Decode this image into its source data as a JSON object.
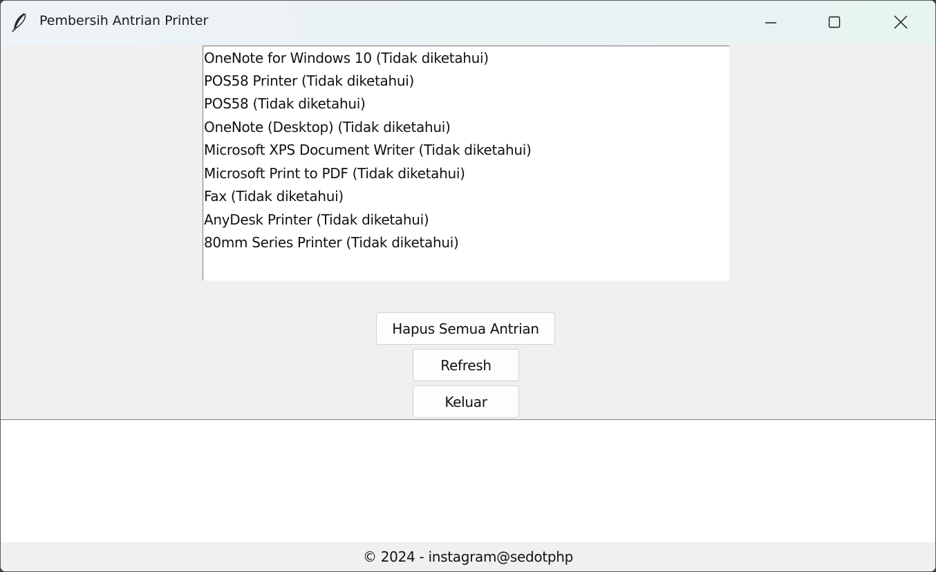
{
  "window": {
    "title": "Pembersih Antrian Printer",
    "controls": {
      "minimize": "minimize-icon",
      "maximize": "maximize-icon",
      "close": "close-icon"
    }
  },
  "printers": {
    "items": [
      "OneNote for Windows 10 (Tidak diketahui)",
      "POS58 Printer (Tidak diketahui)",
      "POS58 (Tidak diketahui)",
      "OneNote (Desktop) (Tidak diketahui)",
      "Microsoft XPS Document Writer (Tidak diketahui)",
      "Microsoft Print to PDF (Tidak diketahui)",
      "Fax (Tidak diketahui)",
      "AnyDesk Printer (Tidak diketahui)",
      "80mm Series Printer (Tidak diketahui)"
    ]
  },
  "actions": {
    "clear_label": "Hapus Semua Antrian",
    "refresh_label": "Refresh",
    "exit_label": "Keluar"
  },
  "status": {
    "text": ""
  },
  "footer": {
    "text": "© 2024 - instagram@sedotphp"
  },
  "colors": {
    "window_bg": "#f0f0f0",
    "list_bg": "#ffffff",
    "text": "#111111"
  }
}
